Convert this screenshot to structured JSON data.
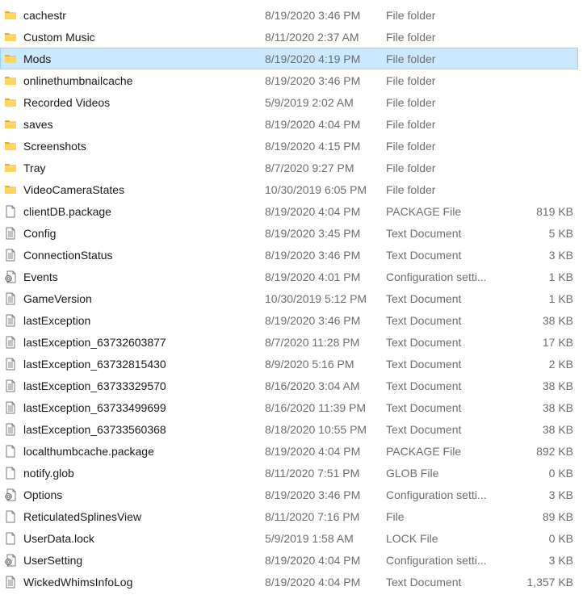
{
  "files": [
    {
      "name": "cachestr",
      "date": "8/19/2020 3:46 PM",
      "type": "File folder",
      "size": "",
      "icon": "folder-icon",
      "selected": false
    },
    {
      "name": "Custom Music",
      "date": "8/11/2020 2:37 AM",
      "type": "File folder",
      "size": "",
      "icon": "folder-icon",
      "selected": false
    },
    {
      "name": "Mods",
      "date": "8/19/2020 4:19 PM",
      "type": "File folder",
      "size": "",
      "icon": "folder-icon",
      "selected": true
    },
    {
      "name": "onlinethumbnailcache",
      "date": "8/19/2020 3:46 PM",
      "type": "File folder",
      "size": "",
      "icon": "folder-icon",
      "selected": false
    },
    {
      "name": "Recorded Videos",
      "date": "5/9/2019 2:02 AM",
      "type": "File folder",
      "size": "",
      "icon": "folder-icon",
      "selected": false
    },
    {
      "name": "saves",
      "date": "8/19/2020 4:04 PM",
      "type": "File folder",
      "size": "",
      "icon": "folder-icon",
      "selected": false
    },
    {
      "name": "Screenshots",
      "date": "8/19/2020 4:15 PM",
      "type": "File folder",
      "size": "",
      "icon": "folder-icon",
      "selected": false
    },
    {
      "name": "Tray",
      "date": "8/7/2020 9:27 PM",
      "type": "File folder",
      "size": "",
      "icon": "folder-icon",
      "selected": false
    },
    {
      "name": "VideoCameraStates",
      "date": "10/30/2019 6:05 PM",
      "type": "File folder",
      "size": "",
      "icon": "folder-icon",
      "selected": false
    },
    {
      "name": "clientDB.package",
      "date": "8/19/2020 4:04 PM",
      "type": "PACKAGE File",
      "size": "819 KB",
      "icon": "blank-file-icon",
      "selected": false
    },
    {
      "name": "Config",
      "date": "8/19/2020 3:45 PM",
      "type": "Text Document",
      "size": "5 KB",
      "icon": "text-document-icon",
      "selected": false
    },
    {
      "name": "ConnectionStatus",
      "date": "8/19/2020 3:46 PM",
      "type": "Text Document",
      "size": "3 KB",
      "icon": "text-document-icon",
      "selected": false
    },
    {
      "name": "Events",
      "date": "8/19/2020 4:01 PM",
      "type": "Configuration setti...",
      "size": "1 KB",
      "icon": "config-settings-icon",
      "selected": false
    },
    {
      "name": "GameVersion",
      "date": "10/30/2019 5:12 PM",
      "type": "Text Document",
      "size": "1 KB",
      "icon": "text-document-icon",
      "selected": false
    },
    {
      "name": "lastException",
      "date": "8/19/2020 3:46 PM",
      "type": "Text Document",
      "size": "38 KB",
      "icon": "text-document-icon",
      "selected": false
    },
    {
      "name": "lastException_63732603877",
      "date": "8/7/2020 11:28 PM",
      "type": "Text Document",
      "size": "17 KB",
      "icon": "text-document-icon",
      "selected": false
    },
    {
      "name": "lastException_63732815430",
      "date": "8/9/2020 5:16 PM",
      "type": "Text Document",
      "size": "2 KB",
      "icon": "text-document-icon",
      "selected": false
    },
    {
      "name": "lastException_63733329570",
      "date": "8/16/2020 3:04 AM",
      "type": "Text Document",
      "size": "38 KB",
      "icon": "text-document-icon",
      "selected": false
    },
    {
      "name": "lastException_63733499699",
      "date": "8/16/2020 11:39 PM",
      "type": "Text Document",
      "size": "38 KB",
      "icon": "text-document-icon",
      "selected": false
    },
    {
      "name": "lastException_63733560368",
      "date": "8/18/2020 10:55 PM",
      "type": "Text Document",
      "size": "38 KB",
      "icon": "text-document-icon",
      "selected": false
    },
    {
      "name": "localthumbcache.package",
      "date": "8/19/2020 4:04 PM",
      "type": "PACKAGE File",
      "size": "892 KB",
      "icon": "blank-file-icon",
      "selected": false
    },
    {
      "name": "notify.glob",
      "date": "8/11/2020 7:51 PM",
      "type": "GLOB File",
      "size": "0 KB",
      "icon": "blank-file-icon",
      "selected": false
    },
    {
      "name": "Options",
      "date": "8/19/2020 3:46 PM",
      "type": "Configuration setti...",
      "size": "3 KB",
      "icon": "config-settings-icon",
      "selected": false
    },
    {
      "name": "ReticulatedSplinesView",
      "date": "8/11/2020 7:16 PM",
      "type": "File",
      "size": "89 KB",
      "icon": "blank-file-icon",
      "selected": false
    },
    {
      "name": "UserData.lock",
      "date": "5/9/2019 1:58 AM",
      "type": "LOCK File",
      "size": "0 KB",
      "icon": "blank-file-icon",
      "selected": false
    },
    {
      "name": "UserSetting",
      "date": "8/19/2020 4:04 PM",
      "type": "Configuration setti...",
      "size": "3 KB",
      "icon": "config-settings-icon",
      "selected": false
    },
    {
      "name": "WickedWhimsInfoLog",
      "date": "8/19/2020 4:04 PM",
      "type": "Text Document",
      "size": "1,357 KB",
      "icon": "text-document-icon",
      "selected": false
    }
  ],
  "colors": {
    "selection_fill": "#cce8ff",
    "selection_border": "#99d1ff",
    "folder_yellow": "#ffd35c",
    "secondary_text": "#6d6d6d"
  }
}
